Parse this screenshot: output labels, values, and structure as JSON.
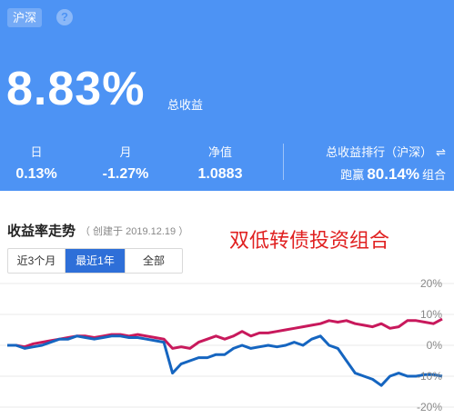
{
  "header": {
    "market_tag": "沪深",
    "help_icon": "?",
    "total_return": "8.83%",
    "total_return_label": "总收益",
    "stats": [
      {
        "label": "日",
        "value": "0.13%"
      },
      {
        "label": "月",
        "value": "-1.27%"
      },
      {
        "label": "净值",
        "value": "1.0883"
      }
    ],
    "rank": {
      "title": "总收益排行（沪深）",
      "swap_icon": "⇌",
      "prefix": "跑赢",
      "value": "80.14%",
      "suffix": "组合"
    }
  },
  "section": {
    "title": "收益率走势",
    "note": "（ 创建于 2019.12.19 ）",
    "overlay_title": "双低转债投资组合"
  },
  "tabs": [
    {
      "label": "近3个月",
      "active": false
    },
    {
      "label": "最近1年",
      "active": true
    },
    {
      "label": "全部",
      "active": false
    }
  ],
  "colors": {
    "header_bg": "#4d93f4",
    "portfolio_line": "#c8195c",
    "benchmark_line": "#1565c0",
    "overlay_title": "#e02020"
  },
  "chart_data": {
    "type": "line",
    "y_ticks": [
      "20%",
      "10%",
      "0%",
      "-10%",
      "-20%"
    ],
    "ylim": [
      -20,
      20
    ],
    "x": [
      0,
      1,
      2,
      3,
      4,
      5,
      6,
      7,
      8,
      9,
      10,
      11,
      12,
      13,
      14,
      15,
      16,
      17,
      18,
      19,
      20,
      21,
      22,
      23,
      24,
      25,
      26,
      27,
      28,
      29,
      30,
      31,
      32,
      33,
      34,
      35,
      36,
      37,
      38,
      39,
      40,
      41,
      42,
      43,
      44,
      45,
      46,
      47,
      48,
      49,
      50
    ],
    "series": [
      {
        "values": [
          0,
          0,
          -0.5,
          0.5,
          1,
          1.5,
          2,
          2.5,
          3,
          3,
          2.5,
          3,
          3.5,
          3.5,
          3,
          3.5,
          3,
          2.5,
          2,
          -1,
          -0.5,
          -1,
          1,
          2,
          3,
          2,
          3,
          4.5,
          3,
          4,
          4,
          4.5,
          5,
          5.5,
          6,
          6.5,
          7,
          8,
          7.5,
          8,
          7,
          6.5,
          6,
          7,
          5.5,
          6,
          8,
          8,
          7.5,
          7,
          8.5
        ]
      },
      {
        "values": [
          0,
          0,
          -1,
          -0.5,
          0,
          1,
          2,
          2,
          3,
          2.5,
          2,
          2.5,
          3,
          3,
          2.5,
          2.5,
          2,
          1.5,
          1,
          -9,
          -6,
          -5,
          -4,
          -4,
          -3,
          -3,
          -1,
          0,
          -1,
          -0.5,
          0,
          -0.5,
          0,
          1,
          0,
          2,
          3,
          0,
          -1,
          -5,
          -9,
          -10,
          -11,
          -13,
          -10,
          -9,
          -10,
          -10,
          -9.5,
          -9.5,
          -10
        ]
      }
    ]
  }
}
